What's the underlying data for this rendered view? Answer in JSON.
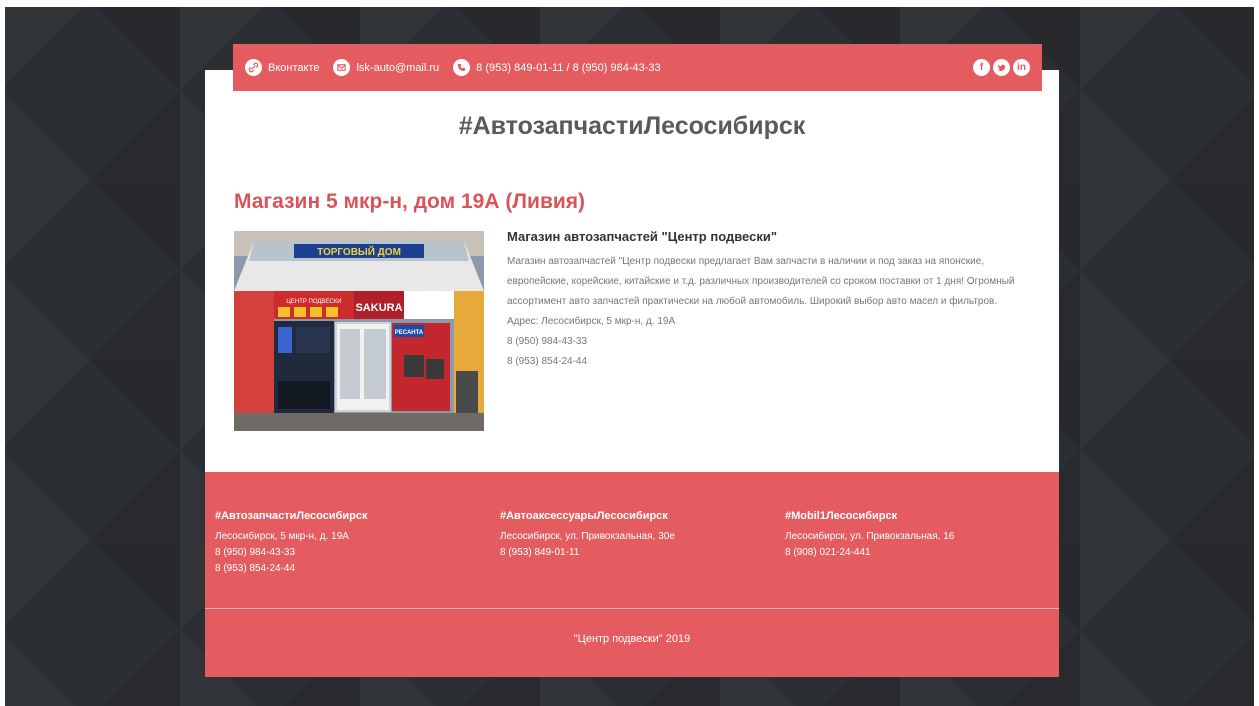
{
  "topbar": {
    "vk_label": "Вконтакте",
    "email": "lsk-auto@mail.ru",
    "phones": "8 (953) 849-01-11 / 8 (950) 984-43-33",
    "social_icons": [
      "facebook-icon",
      "twitter-icon",
      "linkedin-icon"
    ]
  },
  "site_title": "#АвтозапчастиЛесосибирск",
  "shop": {
    "heading": "Магазин 5 мкр-н, дом 19А (Ливия)",
    "image_labels": {
      "top_banner": "ТОРГОВЫЙ ДОМ",
      "brand": "SAKURA",
      "center": "ЦЕНТР ПОДВЕСКИ",
      "resanta": "РЕСАНТА"
    },
    "subtitle": "Магазин автозапчастей \"Центр подвески\"",
    "description": "Магазин автозапчастей \"Центр подвески предлагает Вам запчасти в наличии и под заказ на японские, европейские, корейские, китайские и т.д. различных производителей со сроком поставки от 1 дня! Огромный ассортимент авто запчастей практически на любой автомобиль. Широкий выбор авто масел и фильтров.",
    "address": "Адрес: Лесосибирск, 5 мкр-н, д. 19А",
    "phone1": "8 (950) 984-43-33",
    "phone2": "8 (953) 854-24-44"
  },
  "footer": {
    "columns": [
      {
        "title": "#АвтозапчастиЛесосибирск",
        "lines": [
          "Лесосибирск, 5 мкр-н, д. 19А",
          "8 (950) 984-43-33",
          "8 (953) 854-24-44"
        ]
      },
      {
        "title": "#АвтоаксессуарыЛесосибирск",
        "lines": [
          "Лесосибирск, ул. Привокзальная, 30е",
          "8 (953) 849-01-11"
        ]
      },
      {
        "title": "#Mobil1Лесосибирск",
        "lines": [
          "Лесосибирск, ул. Привокзальная, 16",
          "8 (908) 021-24-441"
        ]
      }
    ],
    "copyright": "\"Центр подвески\" 2019"
  },
  "colors": {
    "accent": "#e45c5f",
    "heading": "#d9545a",
    "background": "#2b2e32"
  }
}
